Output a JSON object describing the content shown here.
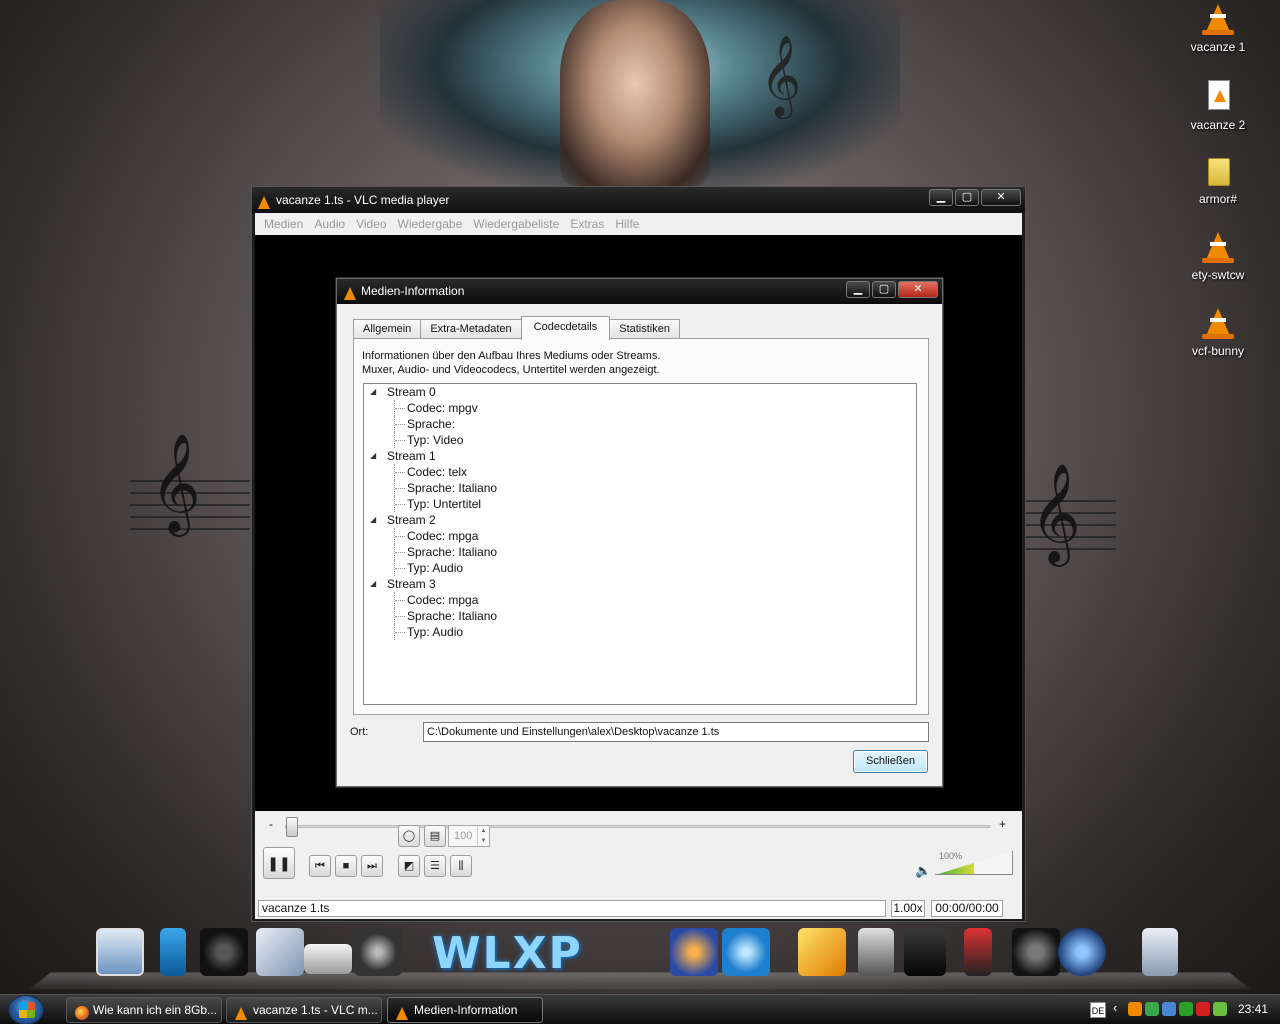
{
  "desktop": {
    "icons": [
      {
        "label": "vacanze 1",
        "icon": "vlc-cone-icon"
      },
      {
        "label": "vacanze 2",
        "icon": "vlc-document-icon"
      },
      {
        "label": "armor#",
        "icon": "folder-icon"
      },
      {
        "label": "ety-swtcw",
        "icon": "vlc-cone-icon"
      },
      {
        "label": "vcf-bunny",
        "icon": "vlc-cone-icon"
      }
    ]
  },
  "vlc": {
    "title": "vacanze 1.ts - VLC media player",
    "menu": [
      "Medien",
      "Audio",
      "Video",
      "Wiedergabe",
      "Wiedergabeliste",
      "Extras",
      "Hilfe"
    ],
    "seek": {
      "minus": "-",
      "plus": "+",
      "position": 0.0
    },
    "spin_value": "100",
    "volume": {
      "percent_label": "100%",
      "level": 0.5
    },
    "status": {
      "file": "vacanze 1.ts",
      "rate": "1.00x",
      "time": "00:00/00:00"
    }
  },
  "dialog": {
    "title": "Medien-Information",
    "tabs": [
      "Allgemein",
      "Extra-Metadaten",
      "Codecdetails",
      "Statistiken"
    ],
    "active_tab": "Codecdetails",
    "description_line1": "Informationen über den Aufbau Ihres Mediums oder Streams.",
    "description_line2": "Muxer, Audio- und Videocodecs, Untertitel werden angezeigt.",
    "streams": [
      {
        "name": "Stream 0",
        "details": [
          "Codec: mpgv",
          "Sprache:",
          "Typ: Video"
        ]
      },
      {
        "name": "Stream 1",
        "details": [
          "Codec: telx",
          "Sprache: Italiano",
          "Typ: Untertitel"
        ]
      },
      {
        "name": "Stream 2",
        "details": [
          "Codec: mpga",
          "Sprache: Italiano",
          "Typ: Audio"
        ]
      },
      {
        "name": "Stream 3",
        "details": [
          "Codec: mpga",
          "Sprache: Italiano",
          "Typ: Audio"
        ]
      }
    ],
    "location_label": "Ort:",
    "location_value": "C:\\Dokumente und Einstellungen\\alex\\Desktop\\vacanze 1.ts",
    "close_label": "Schließen"
  },
  "dock": {
    "logo_text": "WLXP"
  },
  "taskbar": {
    "buttons": [
      {
        "label": "Wie kann ich ein 8Gb...",
        "icon": "firefox-icon"
      },
      {
        "label": "vacanze 1.ts - VLC m...",
        "icon": "vlc-cone-icon"
      },
      {
        "label": "Medien-Information",
        "icon": "vlc-cone-icon"
      }
    ],
    "language": "DE",
    "clock": "23:41"
  }
}
